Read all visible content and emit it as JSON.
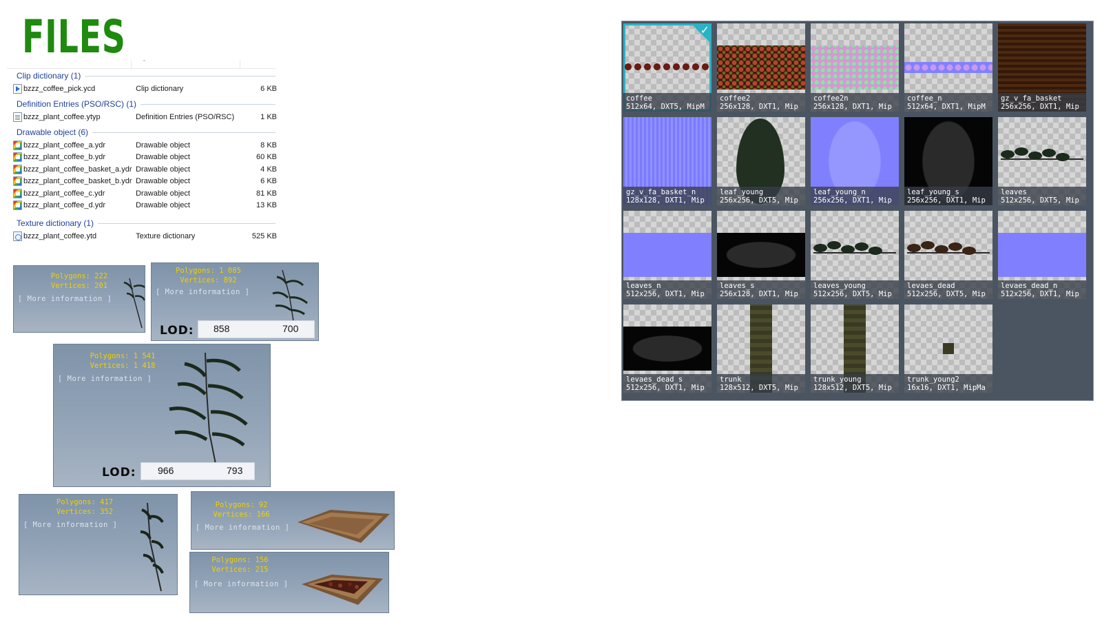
{
  "page": {
    "title": "FILES"
  },
  "explorer": {
    "groups": [
      {
        "header": "Clip dictionary (1)",
        "files": [
          {
            "name": "bzzz_coffee_pick.ycd",
            "type": "Clip dictionary",
            "size": "6 KB",
            "icon": "clip-icon"
          }
        ]
      },
      {
        "header": "Definition Entries (PSO/RSC) (1)",
        "files": [
          {
            "name": "bzzz_plant_coffee.ytyp",
            "type": "Definition Entries (PSO/RSC)",
            "size": "1 KB",
            "icon": "document-icon"
          }
        ]
      },
      {
        "header": "Drawable object (6)",
        "files": [
          {
            "name": "bzzz_plant_coffee_a.ydr",
            "type": "Drawable object",
            "size": "8 KB",
            "icon": "model-icon"
          },
          {
            "name": "bzzz_plant_coffee_b.ydr",
            "type": "Drawable object",
            "size": "60 KB",
            "icon": "model-icon"
          },
          {
            "name": "bzzz_plant_coffee_basket_a.ydr",
            "type": "Drawable object",
            "size": "4 KB",
            "icon": "model-icon"
          },
          {
            "name": "bzzz_plant_coffee_basket_b.ydr",
            "type": "Drawable object",
            "size": "6 KB",
            "icon": "model-icon"
          },
          {
            "name": "bzzz_plant_coffee_c.ydr",
            "type": "Drawable object",
            "size": "81 KB",
            "icon": "model-icon"
          },
          {
            "name": "bzzz_plant_coffee_d.ydr",
            "type": "Drawable object",
            "size": "13 KB",
            "icon": "model-icon"
          }
        ]
      },
      {
        "header": "Texture dictionary (1)",
        "files": [
          {
            "name": "bzzz_plant_coffee.ytd",
            "type": "Texture dictionary",
            "size": "525 KB",
            "icon": "texture-icon"
          }
        ]
      }
    ]
  },
  "models": [
    {
      "polygons": "Polygons: 222",
      "vertices": "Vertices: 201",
      "more": "[ More information ]"
    },
    {
      "polygons": "Polygons: 1 085",
      "vertices": "Vertices: 892",
      "more": "[ More information ]",
      "lod_label": "LOD:",
      "lod": [
        "858",
        "700"
      ]
    },
    {
      "polygons": "Polygons: 1 541",
      "vertices": "Vertices: 1 418",
      "more": "[ More information ]",
      "lod_label": "LOD:",
      "lod": [
        "966",
        "793"
      ]
    },
    {
      "polygons": "Polygons: 417",
      "vertices": "Vertices: 352",
      "more": "[ More information ]"
    },
    {
      "polygons": "Polygons: 92",
      "vertices": "Vertices: 166",
      "more": "[ More information ]"
    },
    {
      "polygons": "Polygons: 156",
      "vertices": "Vertices: 215",
      "more": "[ More information ]"
    }
  ],
  "textures": [
    {
      "name": "coffee",
      "info": "512x64, DXT5, MipM",
      "selected": true
    },
    {
      "name": "coffee2",
      "info": "256x128, DXT1, Mip"
    },
    {
      "name": "coffee2n",
      "info": "256x128, DXT1, Mip"
    },
    {
      "name": "coffee_n",
      "info": "512x64, DXT1, MipM"
    },
    {
      "name": "gz_v_fa_basket",
      "info": "256x256, DXT1, Mip"
    },
    {
      "name": "gz_v_fa_basket_n",
      "info": "128x128, DXT1, Mip"
    },
    {
      "name": "leaf_young",
      "info": "256x256, DXT5, Mip"
    },
    {
      "name": "leaf_young_n",
      "info": "256x256, DXT1, Mip"
    },
    {
      "name": "leaf_young_s",
      "info": "256x256, DXT1, Mip"
    },
    {
      "name": "leaves",
      "info": "512x256, DXT5, Mip"
    },
    {
      "name": "leaves_n",
      "info": "512x256, DXT1, Mip"
    },
    {
      "name": "leaves_s",
      "info": "256x128, DXT1, Mip"
    },
    {
      "name": "leaves_young",
      "info": "512x256, DXT5, Mip"
    },
    {
      "name": "levaes_dead",
      "info": "512x256, DXT5, Mip"
    },
    {
      "name": "levaes_dead_n",
      "info": "512x256, DXT1, Mip"
    },
    {
      "name": "levaes_dead_s",
      "info": "512x256, DXT1, Mip"
    },
    {
      "name": "trunk",
      "info": "128x512, DXT5, Mip"
    },
    {
      "name": "trunk_young",
      "info": "128x512, DXT5, Mip"
    },
    {
      "name": "trunk_young2",
      "info": "16x16, DXT1, MipMa"
    }
  ],
  "colors": {
    "title_green": "#1e8a0e",
    "stats_yellow": "#f0d000",
    "panel_bg": "#4b5562",
    "selection_teal": "#29b3c5",
    "group_blue": "#1f3f99"
  }
}
